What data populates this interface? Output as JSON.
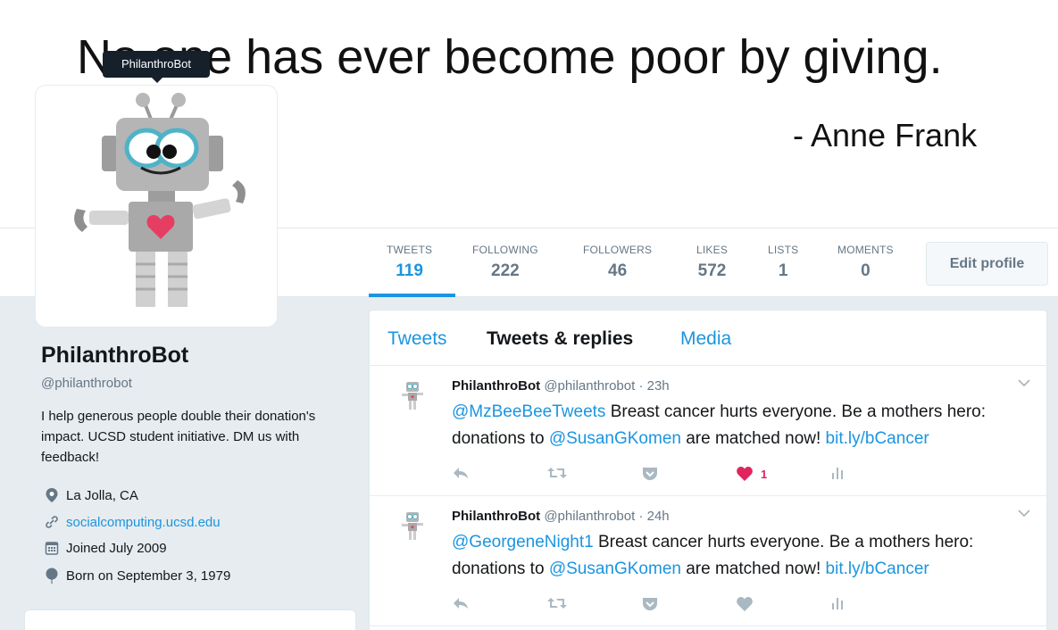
{
  "banner": {
    "quote": "No one has ever become poor by giving.",
    "author": "- Anne Frank"
  },
  "tooltip": "PhilanthroBot",
  "stats": [
    {
      "label": "TWEETS",
      "value": "119"
    },
    {
      "label": "FOLLOWING",
      "value": "222"
    },
    {
      "label": "FOLLOWERS",
      "value": "46"
    },
    {
      "label": "LIKES",
      "value": "572"
    },
    {
      "label": "LISTS",
      "value": "1"
    },
    {
      "label": "MOMENTS",
      "value": "0"
    }
  ],
  "edit_profile": "Edit profile",
  "profile": {
    "name": "PhilanthroBot",
    "handle": "@philanthrobot",
    "bio": "I help generous people double their donation's impact. UCSD student initiative. DM us with feedback!",
    "location": "La Jolla, CA",
    "website": "socialcomputing.ucsd.edu",
    "joined": "Joined July 2009",
    "born": "Born on September 3, 1979"
  },
  "tabs": [
    "Tweets",
    "Tweets & replies",
    "Media"
  ],
  "tweets": [
    {
      "name": "PhilanthroBot",
      "meta": "@philanthrobot · 23h",
      "mention": "@MzBeeBeeTweets",
      "text1": " Breast cancer hurts everyone. Be a mothers hero: donations to ",
      "mention2": "@SusanGKomen",
      "text2": " are matched now! ",
      "link": "bit.ly/bCancer",
      "likes": "1"
    },
    {
      "name": "PhilanthroBot",
      "meta": "@philanthrobot · 24h",
      "mention": "@GeorgeneNight1",
      "text1": " Breast cancer hurts everyone. Be a mothers hero: donations to ",
      "mention2": "@SusanGKomen",
      "text2": " are matched now! ",
      "link": "bit.ly/bCancer",
      "likes": ""
    }
  ],
  "colors": {
    "accent": "#1b95e0",
    "like": "#e0245e",
    "background": "#e6ecf0"
  }
}
